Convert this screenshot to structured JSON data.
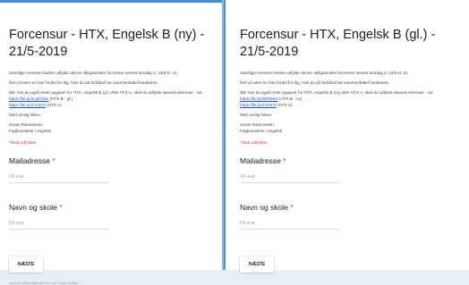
{
  "left_form": {
    "title": "Forcensur - HTX, Engelsk B (ny) - 21/5-2019",
    "intro": "Samtlige censorer bedes udfylde denne obligatoriske forcensur senest torsdag d. 13/6 kl. 12.",
    "benefit": "Det vil være en stor fordel for dig, hvis du på forhånd har sammenfattet karakterer.",
    "note": "NB: Har du også rettet opgaver for HTX, engelsk B (gl.) eller HTX A, skal du udfylde separat skemaer - Se:",
    "link_1": "https://bit.ly/2LqKONz",
    "link_1_suffix": "(HTX B - gl.)",
    "link_2": "https://bit.ly/2V24rr3",
    "link_2_suffix": "(HTX A)",
    "greeting": "Med venlig hilsen",
    "signer_name": "Jonas Rasmussen",
    "signer_title": "Fagkonsulent i engelsk",
    "required_note": "*Skal udfyldes",
    "email_label": "Mailadresse",
    "email_placeholder": "Dit svar",
    "name_label": "Navn og skole",
    "name_placeholder": "Dit svar",
    "next_button": "NÆSTE",
    "footer": "Indsend aldrig adgangskoder via Google Analyse."
  },
  "right_form": {
    "title": "Forcensur - HTX, Engelsk B (gl.) - 21/5-2019",
    "intro": "Samtlige censorer bedes udfylde denne obligatoriske forcensur senest torsdag d. 13/6 kl. 12.",
    "benefit": "Det vil være en stor fordel for dig, hvis du på forhånd har sammenfattet karakterer.",
    "note": "NB: Har du også rettet opgaver for HTX, engelsk B (ny) eller HTX A, skal du udfylde separat skemaer - Se:",
    "link_1": "https://bit.ly/2Et0Mv0",
    "link_1_suffix": "(HTX B - ny)",
    "link_2": "https://bit.ly/2V24rr3",
    "link_2_suffix": "(HTX A)",
    "greeting": "Med venlig hilsen",
    "signer_name": "Jonas Rasmussen",
    "signer_title": "Fagkonsulent i engelsk",
    "required_note": "*Skal udfyldes",
    "email_label": "Mailadresse",
    "email_placeholder": "Dit svar",
    "name_label": "Navn og skole",
    "name_placeholder": "Dit svar",
    "next_button": "NÆSTE"
  },
  "colors": {
    "accent": "#3f8fd2",
    "required": "#d93025",
    "link": "#1a56c8",
    "background": "#e8eef6"
  }
}
